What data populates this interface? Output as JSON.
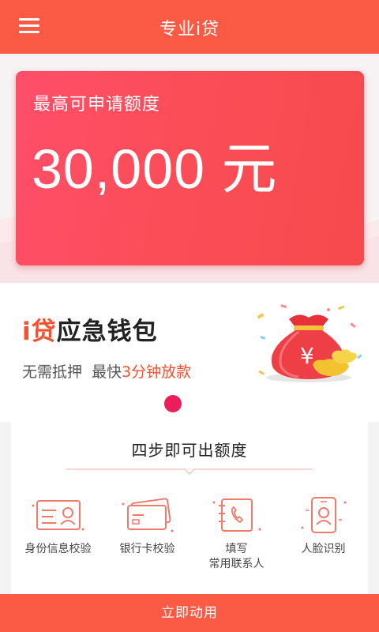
{
  "header": {
    "title": "专业i贷"
  },
  "limit_card": {
    "label": "最高可申请额度",
    "amount": "30,000 元"
  },
  "promo": {
    "title_accent": "i贷",
    "title_rest": "应急钱包",
    "sub_prefix": "无需抵押  最快",
    "sub_accent": "3分钟放款",
    "bag_symbol": "¥"
  },
  "steps": {
    "title": "四步即可出额度",
    "items": [
      {
        "label": "身份信息校验",
        "icon": "id-card-icon"
      },
      {
        "label": "银行卡校验",
        "icon": "bank-card-icon"
      },
      {
        "label": "填写\n常用联系人",
        "icon": "contacts-book-icon"
      },
      {
        "label": "人脸识别",
        "icon": "face-recognition-icon"
      }
    ]
  },
  "footer": {
    "button_label": "立即动用"
  },
  "colors": {
    "primary": "#fb5a45",
    "card": "#fb4d58",
    "accent": "#f4512f",
    "dot": "#e91e5a"
  }
}
